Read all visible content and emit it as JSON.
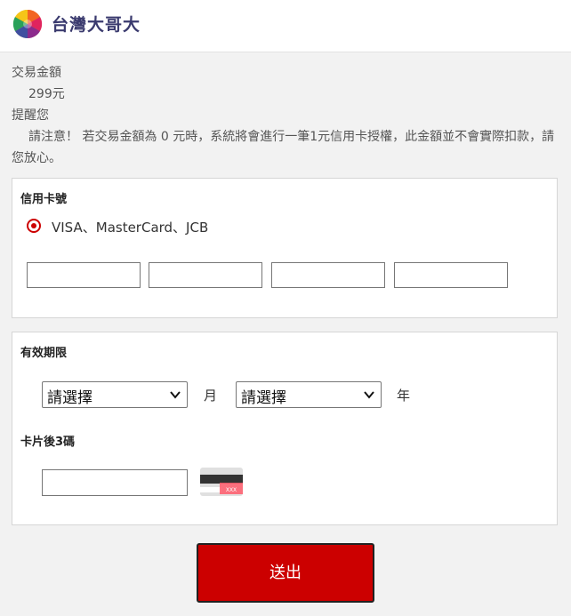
{
  "header": {
    "brand": "台灣大哥大",
    "logo_icon": "colorful-flower-logo-icon"
  },
  "info": {
    "amount_label": "交易金額",
    "amount_value": "299元",
    "notice_label": "提醒您",
    "notice_text": "請注意！ 若交易金額為 0 元時，系統將會進行一筆1元信用卡授權，此金額並不會實際扣款，請您放心。"
  },
  "card_section": {
    "title": "信用卡號",
    "card_types": "VISA、MasterCard、JCB",
    "radio_selected": true,
    "inputs": [
      "",
      "",
      "",
      ""
    ]
  },
  "expiry_section": {
    "title": "有效期限",
    "month_select": "請選擇",
    "month_unit": "月",
    "year_select": "請選擇",
    "year_unit": "年",
    "cvv_title": "卡片後3碼",
    "cvv_value": "",
    "cvv_hint_text": "XXX"
  },
  "submit_label": "送出",
  "colors": {
    "accent": "#cc0000",
    "brand_text": "#3a3a6e"
  }
}
